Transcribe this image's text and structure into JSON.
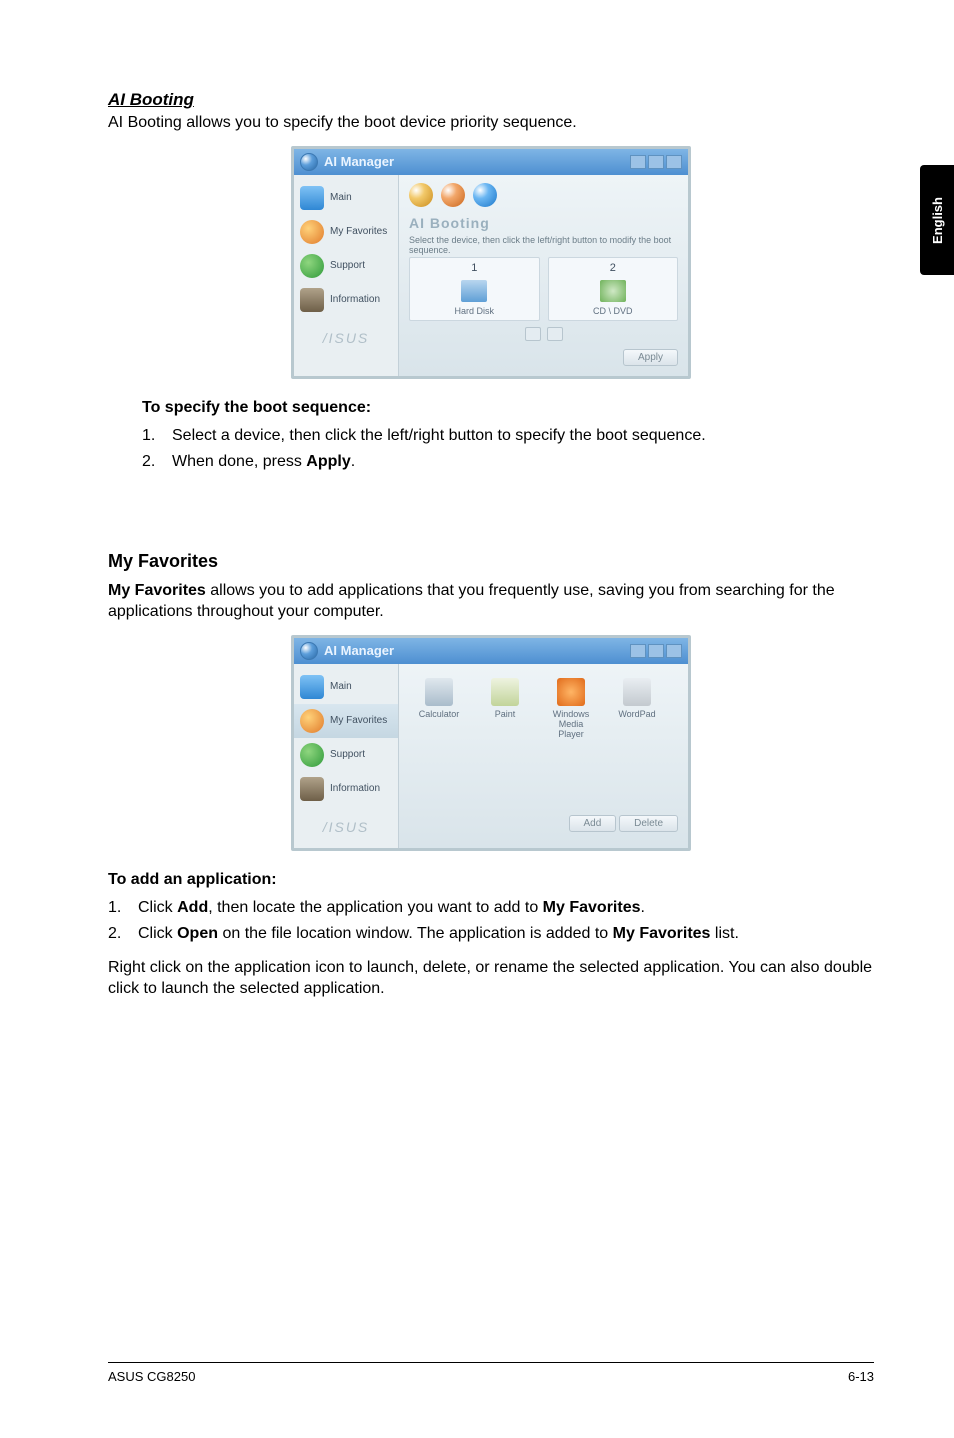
{
  "sideTab": "English",
  "sections": {
    "aiBooting": {
      "heading": "AI Booting",
      "intro": "AI Booting allows you to specify the boot device priority sequence.",
      "stepsHeading": "To specify the boot sequence:",
      "steps": [
        {
          "num": "1.",
          "text_pre": "Select a device, then click the left/right button to specify the boot sequence."
        },
        {
          "num": "2.",
          "text_pre": "When done, press ",
          "bold": "Apply",
          "text_post": "."
        }
      ]
    },
    "myFavorites": {
      "heading": "My Favorites",
      "introBold": "My Favorites",
      "introRest": " allows you to add applications that you frequently use, saving you from searching for the applications throughout your computer.",
      "stepsHeading": "To add an application:",
      "steps": [
        {
          "num": "1.",
          "parts": [
            "Click ",
            "Add",
            ", then locate the application you want to add to ",
            "My Favorites",
            "."
          ]
        },
        {
          "num": "2.",
          "parts": [
            "Click ",
            "Open",
            " on the file location window. The application is added to ",
            "My Favorites",
            " list."
          ]
        }
      ],
      "after": "Right click on the application icon to launch, delete, or rename the selected application. You can also double click to launch the selected application."
    }
  },
  "aiManager": {
    "title": "AI Manager",
    "nav": {
      "main": "Main",
      "favorites": "My Favorites",
      "support": "Support",
      "information": "Information",
      "logo": "/ISUS"
    },
    "bootPane": {
      "title": "AI Booting",
      "subtitle": "Select the device, then click the left/right button to modify the boot sequence.",
      "cols": [
        {
          "num": "1",
          "label": "Hard Disk"
        },
        {
          "num": "2",
          "label": "CD \\ DVD"
        }
      ],
      "applyBtn": "Apply"
    },
    "favPane": {
      "apps": [
        {
          "label": "Calculator"
        },
        {
          "label": "Paint"
        },
        {
          "label": "Windows Media Player"
        },
        {
          "label": "WordPad"
        }
      ],
      "addBtn": "Add",
      "deleteBtn": "Delete"
    }
  },
  "footer": {
    "left": "ASUS CG8250",
    "right": "6-13"
  }
}
